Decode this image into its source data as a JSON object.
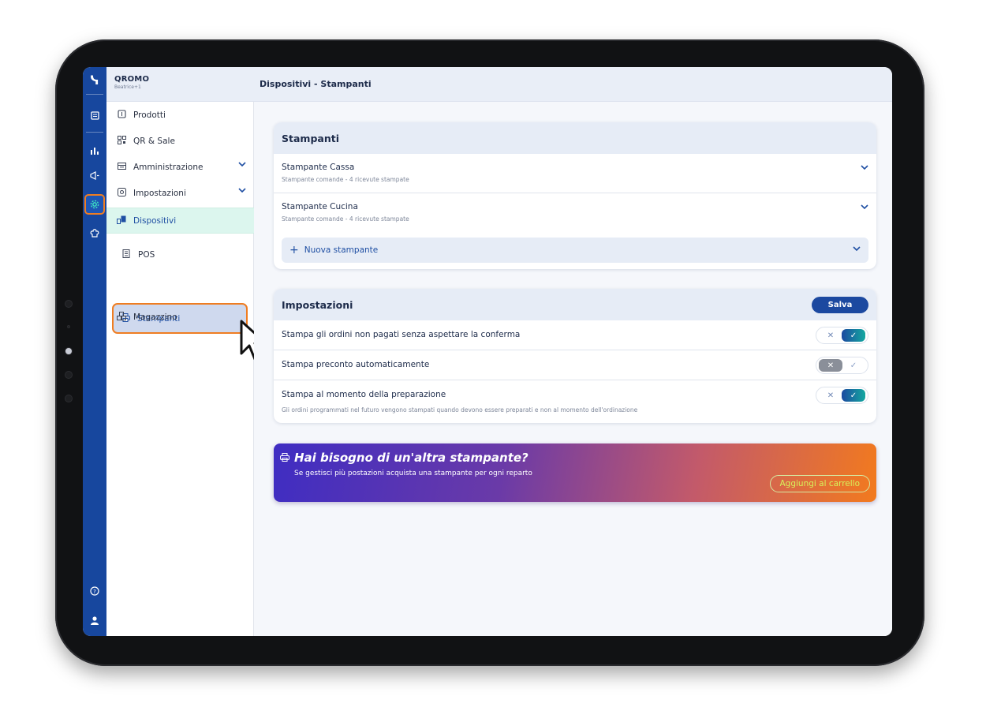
{
  "app": {
    "brand_name": "QROMO",
    "brand_user": "Beatrice+1",
    "page_title": "Dispositivi - Stampanti"
  },
  "rail": {
    "icons": [
      "menu-book-icon",
      "bar-chart-icon",
      "megaphone-icon",
      "gear-icon",
      "chef-hat-icon",
      "help-icon",
      "user-icon"
    ],
    "active": "gear-icon"
  },
  "sidebar": {
    "items": [
      {
        "label": "Prodotti",
        "icon": "menu-card-icon"
      },
      {
        "label": "QR & Sale",
        "icon": "qr-code-icon"
      },
      {
        "label": "Amministrazione",
        "icon": "admin-icon",
        "expandable": true
      },
      {
        "label": "Impostazioni",
        "icon": "settings-icon",
        "expandable": true
      },
      {
        "label": "Dispositivi",
        "icon": "devices-icon",
        "selected": true
      },
      {
        "label": "POS",
        "icon": "pos-icon"
      },
      {
        "label": "Stampanti",
        "icon": "printer-icon",
        "selected": true
      },
      {
        "label": "Magazzino",
        "icon": "warehouse-icon"
      }
    ]
  },
  "printers": {
    "title": "Stampanti",
    "items": [
      {
        "name": "Stampante Cassa",
        "subtitle": "Stampante comande - 4 ricevute stampate"
      },
      {
        "name": "Stampante Cucina",
        "subtitle": "Stampante comande - 4 ricevute stampate"
      }
    ],
    "new_label": "Nuova stampante"
  },
  "settings": {
    "title": "Impostazioni",
    "save_label": "Salva",
    "rows": [
      {
        "label": "Stampa gli ordini non pagati senza aspettare la conferma",
        "enabled": true
      },
      {
        "label": "Stampa preconto automaticamente",
        "enabled": false
      },
      {
        "label": "Stampa al momento della preparazione",
        "enabled": true,
        "description": "Gli ordini programmati nel futuro vengono stampati quando devono essere preparati e non al momento dell'ordinazione"
      }
    ]
  },
  "promo": {
    "title": "Hai bisogno di un'altra stampante?",
    "description": "Se gestisci più postazioni acquista una stampante per ogni reparto",
    "button_label": "Aggiungi al carrello"
  },
  "colors": {
    "rail": "#17479e",
    "accent": "#1f4fa3",
    "highlight": "#ef7d22",
    "teal": "#14a8a0"
  }
}
